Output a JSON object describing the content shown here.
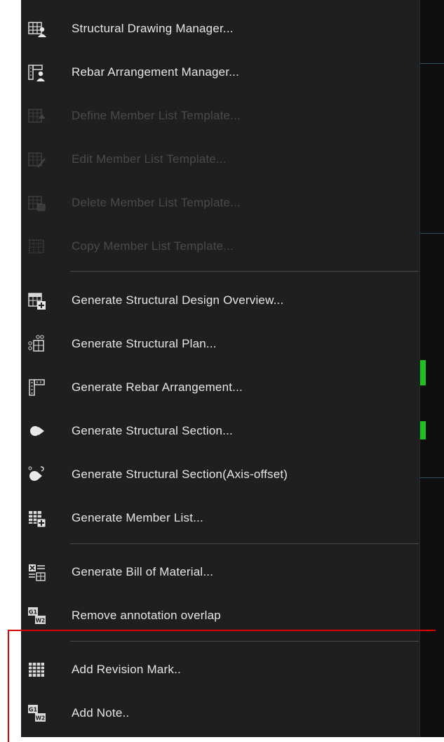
{
  "colors": {
    "menu_bg": "#1f1f1f",
    "text_enabled": "#e6e6e6",
    "text_disabled": "#4a4a4a",
    "separator": "#4a4a4a",
    "highlight_box": "#e00000"
  },
  "menu": {
    "items": [
      {
        "label": "Structural Drawing Manager...",
        "icon": "drawing-manager-icon",
        "enabled": true
      },
      {
        "label": "Rebar Arrangement Manager...",
        "icon": "rebar-manager-icon",
        "enabled": true
      },
      {
        "label": "Define Member List Template...",
        "icon": "define-template-icon",
        "enabled": false
      },
      {
        "label": "Edit Member List Template...",
        "icon": "edit-template-icon",
        "enabled": false
      },
      {
        "label": "Delete Member List Template...",
        "icon": "delete-template-icon",
        "enabled": false
      },
      {
        "label": "Copy Member List Template...",
        "icon": "copy-template-icon",
        "enabled": false
      },
      {
        "label": "Generate Structural Design Overview...",
        "icon": "design-overview-icon",
        "enabled": true
      },
      {
        "label": "Generate Structural Plan...",
        "icon": "structural-plan-icon",
        "enabled": true
      },
      {
        "label": "Generate Rebar Arrangement...",
        "icon": "rebar-arrangement-icon",
        "enabled": true
      },
      {
        "label": "Generate Structural Section...",
        "icon": "structural-section-icon",
        "enabled": true
      },
      {
        "label": "Generate Structural Section(Axis-offset)",
        "icon": "section-axis-offset-icon",
        "enabled": true
      },
      {
        "label": "Generate Member List...",
        "icon": "member-list-icon",
        "enabled": true
      },
      {
        "label": "Generate Bill of Material...",
        "icon": "bill-of-material-icon",
        "enabled": true
      },
      {
        "label": "Remove annotation overlap",
        "icon": "annotation-overlap-icon",
        "enabled": true
      },
      {
        "label": "Add Revision Mark..",
        "icon": "revision-mark-icon",
        "enabled": true
      },
      {
        "label": "Add Note..",
        "icon": "add-note-icon",
        "enabled": true
      }
    ],
    "icon_glyphs": {
      "g1": "G1",
      "w2": "W2"
    }
  }
}
